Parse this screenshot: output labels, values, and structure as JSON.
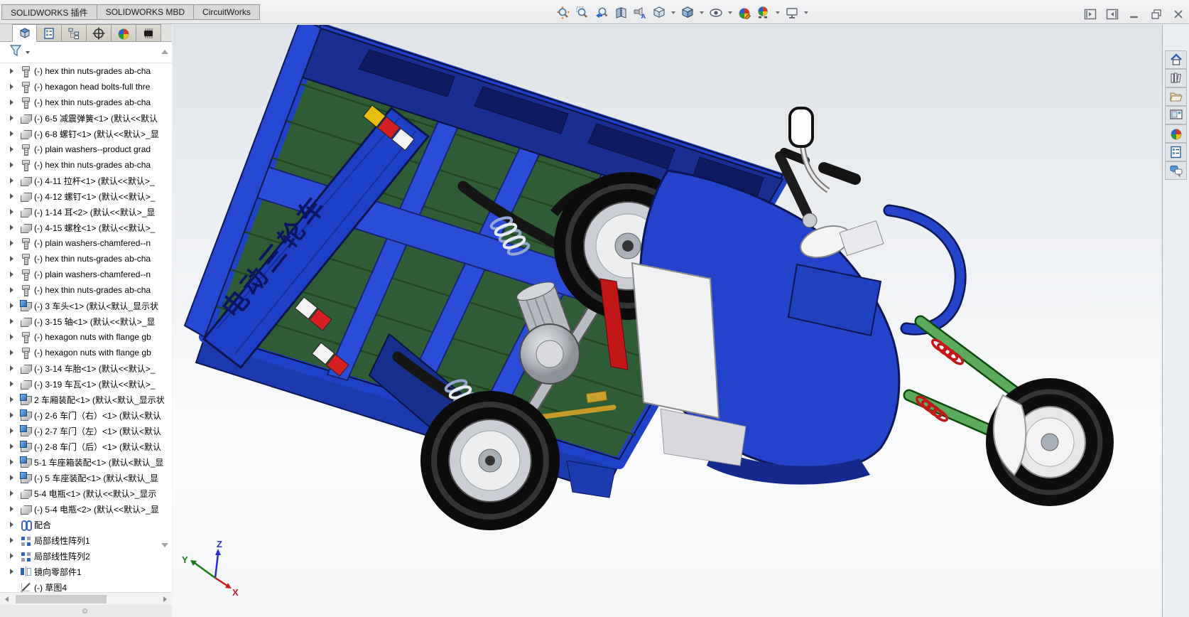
{
  "window": {
    "tabs": [
      {
        "label": "SOLIDWORKS 插件"
      },
      {
        "label": "SOLIDWORKS MBD"
      },
      {
        "label": "CircuitWorks"
      }
    ],
    "window_buttons": [
      {
        "icon": "dock-left-icon"
      },
      {
        "icon": "dock-right-icon"
      },
      {
        "icon": "minimize-icon"
      },
      {
        "icon": "restore-icon"
      },
      {
        "icon": "close-icon"
      }
    ]
  },
  "toolbar": {
    "buttons": [
      {
        "icon": "zoom-to-fit-icon",
        "dropdown": false
      },
      {
        "icon": "zoom-to-area-icon",
        "dropdown": false
      },
      {
        "icon": "previous-view-icon",
        "dropdown": false
      },
      {
        "icon": "section-view-icon",
        "dropdown": false
      },
      {
        "icon": "annotation-views-icon",
        "dropdown": false
      },
      {
        "icon": "view-orientation-icon",
        "dropdown": true
      },
      {
        "icon": "display-style-icon",
        "dropdown": true
      },
      {
        "icon": "hide-show-items-icon",
        "dropdown": true
      },
      {
        "icon": "edit-appearance-icon",
        "dropdown": false
      },
      {
        "icon": "apply-scene-icon",
        "dropdown": true
      },
      {
        "icon": "view-settings-icon",
        "dropdown": true
      }
    ]
  },
  "sidebar": {
    "panel_tabs": [
      {
        "icon": "featuremanager-tab-icon",
        "active": true
      },
      {
        "icon": "propertymanager-tab-icon",
        "active": false
      },
      {
        "icon": "configurationmanager-tab-icon",
        "active": false
      },
      {
        "icon": "dimxpertmanager-tab-icon",
        "active": false
      },
      {
        "icon": "displaymanager-tab-icon",
        "active": false
      },
      {
        "icon": "circuitworks-tab-icon",
        "active": false
      }
    ],
    "filter_icon": "filter-funnel-icon",
    "tree_items": [
      {
        "icon": "bolt",
        "label": "(-) hex thin nuts-grades ab-cha",
        "expandable": true
      },
      {
        "icon": "bolt",
        "label": "(-) hexagon head bolts-full thre",
        "expandable": true
      },
      {
        "icon": "bolt",
        "label": "(-) hex thin nuts-grades ab-cha",
        "expandable": true
      },
      {
        "icon": "part",
        "label": "(-) 6-5 减震弹簧<1> (默认<<默认",
        "expandable": true
      },
      {
        "icon": "part",
        "label": "(-) 6-8 螺钉<1> (默认<<默认>_显",
        "expandable": true
      },
      {
        "icon": "bolt",
        "label": "(-) plain washers--product grad",
        "expandable": true
      },
      {
        "icon": "bolt",
        "label": "(-) hex thin nuts-grades ab-cha",
        "expandable": true
      },
      {
        "icon": "part",
        "label": "(-) 4-11 拉杆<1> (默认<<默认>_",
        "expandable": true
      },
      {
        "icon": "part",
        "label": "(-) 4-12 螺钉<1> (默认<<默认>_",
        "expandable": true
      },
      {
        "icon": "part",
        "label": "(-) 1-14 耳<2> (默认<<默认>_显",
        "expandable": true
      },
      {
        "icon": "part",
        "label": "(-) 4-15 螺栓<1> (默认<<默认>_",
        "expandable": true
      },
      {
        "icon": "bolt",
        "label": "(-) plain washers-chamfered--n",
        "expandable": true
      },
      {
        "icon": "bolt",
        "label": "(-) hex thin nuts-grades ab-cha",
        "expandable": true
      },
      {
        "icon": "bolt",
        "label": "(-) plain washers-chamfered--n",
        "expandable": true
      },
      {
        "icon": "bolt",
        "label": "(-) hex thin nuts-grades ab-cha",
        "expandable": true
      },
      {
        "icon": "assembly",
        "label": "(-) 3 车头<1> (默认<默认_显示状",
        "expandable": true
      },
      {
        "icon": "part",
        "label": "(-) 3-15 轴<1> (默认<<默认>_显",
        "expandable": true
      },
      {
        "icon": "bolt",
        "label": "(-) hexagon nuts with flange gb",
        "expandable": true
      },
      {
        "icon": "bolt",
        "label": "(-) hexagon nuts with flange gb",
        "expandable": true
      },
      {
        "icon": "part",
        "label": "(-) 3-14 车胎<1> (默认<<默认>_",
        "expandable": true
      },
      {
        "icon": "part",
        "label": "(-) 3-19 车瓦<1> (默认<<默认>_",
        "expandable": true
      },
      {
        "icon": "assembly",
        "label": "2 车厢装配<1> (默认<默认_显示状",
        "expandable": true
      },
      {
        "icon": "assembly",
        "label": "(-) 2-6 车门（右）<1> (默认<默认",
        "expandable": true
      },
      {
        "icon": "assembly",
        "label": "(-) 2-7 车门（左）<1> (默认<默认",
        "expandable": true
      },
      {
        "icon": "assembly",
        "label": "(-) 2-8 车门（后）<1> (默认<默认",
        "expandable": true
      },
      {
        "icon": "assembly",
        "label": "5-1 车座箱装配<1> (默认<默认_显",
        "expandable": true
      },
      {
        "icon": "assembly",
        "label": "(-) 5 车座装配<1> (默认<默认_显",
        "expandable": true
      },
      {
        "icon": "part",
        "label": "5-4 电瓶<1> (默认<<默认>_显示",
        "expandable": true
      },
      {
        "icon": "part",
        "label": "(-) 5-4 电瓶<2> (默认<<默认>_显",
        "expandable": true
      },
      {
        "icon": "mates",
        "label": "配合",
        "expandable": true
      },
      {
        "icon": "pattern",
        "label": "局部线性阵列1",
        "expandable": true
      },
      {
        "icon": "pattern",
        "label": "局部线性阵列2",
        "expandable": true
      },
      {
        "icon": "mirror",
        "label": "镜向零部件1",
        "expandable": true
      },
      {
        "icon": "sketch",
        "label": "(-) 草图4",
        "expandable": false
      }
    ]
  },
  "taskpane": {
    "items": [
      {
        "icon": "home-icon"
      },
      {
        "icon": "design-library-icon"
      },
      {
        "icon": "file-explorer-icon"
      },
      {
        "icon": "view-palette-icon"
      },
      {
        "icon": "appearances-scenes-icon"
      },
      {
        "icon": "custom-properties-icon"
      },
      {
        "icon": "solidworks-forum-icon"
      }
    ]
  },
  "viewport": {
    "model_label": "电动三轮车",
    "triad": {
      "x": "X",
      "y": "Y",
      "z": "Z"
    }
  },
  "colors": {
    "model_blue": "#2243ca",
    "model_dark_blue": "#13288c",
    "bed_green": "#2e5c34",
    "fork_green": "#5cab5c",
    "spring_red": "#c41818",
    "reflector_red": "#d42020",
    "reflector_yellow": "#e8bc10",
    "gold": "#c79a2a"
  }
}
